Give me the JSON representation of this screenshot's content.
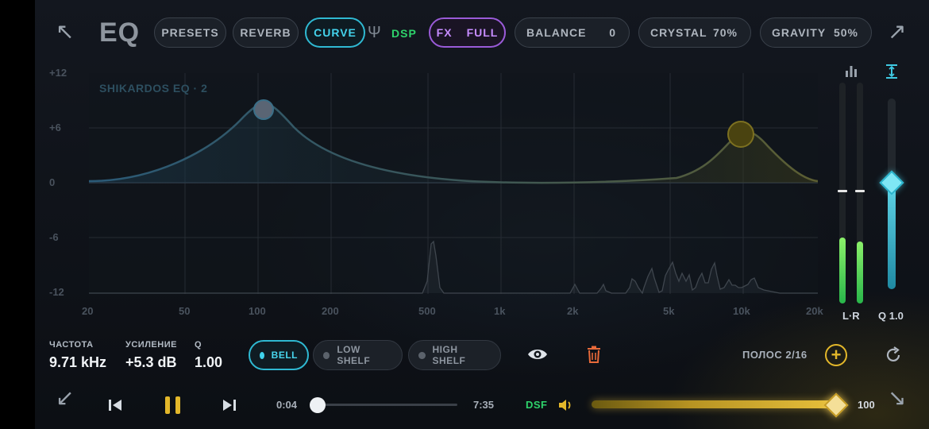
{
  "top_bar": {
    "title": "EQ",
    "presets": "PRESETS",
    "reverb": "REVERB",
    "curve": "CURVE",
    "dsp": "DSP",
    "fx": "FX",
    "full": "FULL",
    "balance": {
      "label": "BALANCE",
      "value": "0"
    },
    "crystal": {
      "label": "CRYSTAL",
      "value": "70%"
    },
    "gravity": {
      "label": "GRAVITY",
      "value": "50%"
    }
  },
  "graph": {
    "band_label": "SHIKARDOS EQ  ·  2",
    "y_labels": [
      "+12",
      "+6",
      "0",
      "-6",
      "-12"
    ],
    "x_labels": [
      "20",
      "50",
      "100",
      "200",
      "500",
      "1k",
      "2k",
      "5k",
      "10k",
      "20k"
    ]
  },
  "meters": {
    "channels_label": "L·R",
    "q_label": "Q 1.0",
    "left_level": 0.3,
    "right_level": 0.28,
    "q_value": 0.55
  },
  "params": {
    "freq_label": "ЧАСТОТА",
    "freq_value": "9.71 kHz",
    "gain_label": "УСИЛЕНИЕ",
    "gain_value": "+5.3 dB",
    "q_label": "Q",
    "q_value": "1.00"
  },
  "filter_shapes": [
    "BELL",
    "LOW SHELF",
    "HIGH SHELF"
  ],
  "bands_text": "ПОЛОС 2/16",
  "player": {
    "current_time": "0:04",
    "total_time": "7:35",
    "progress": 0.009,
    "format": "DSF",
    "volume": "100"
  },
  "colors": {
    "accent_cyan": "#2fb9d2",
    "accent_purple": "#9a5bd8",
    "accent_green": "#2ed36b",
    "accent_gold": "#e3b72a"
  }
}
